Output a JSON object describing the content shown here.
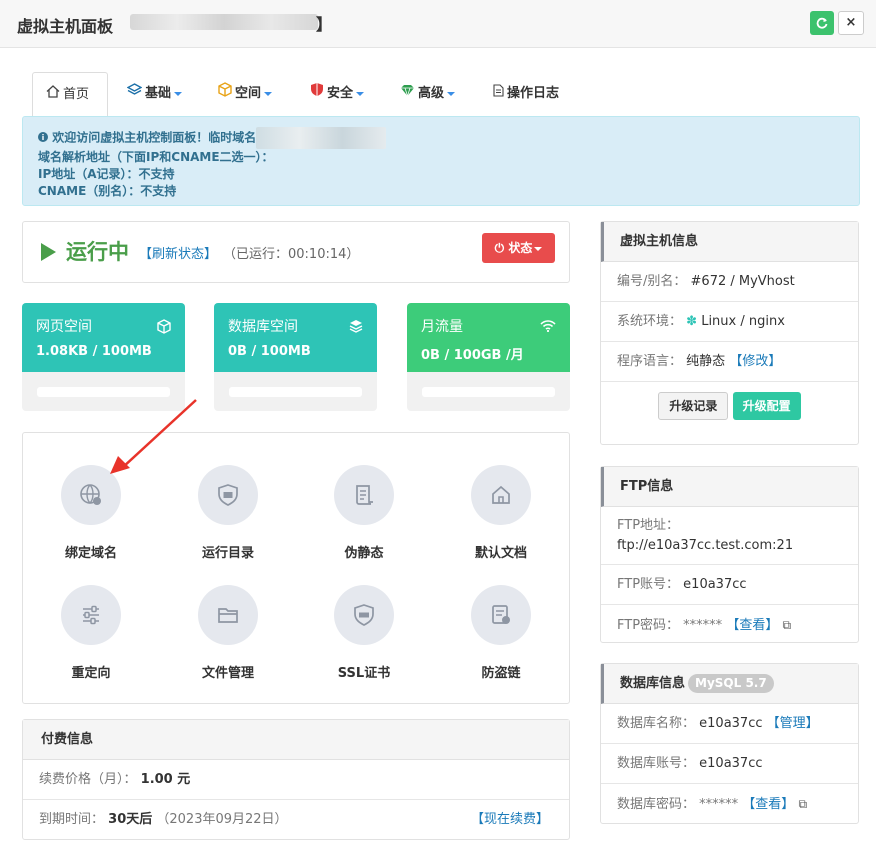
{
  "window": {
    "title": "虚拟主机面板",
    "title_suffix": "】",
    "refresh_icon": "refresh-icon",
    "close_label": "×"
  },
  "tabs": [
    {
      "label": "首页",
      "icon": "home-icon"
    },
    {
      "label": "基础",
      "icon": "layers-icon"
    },
    {
      "label": "空间",
      "icon": "cube-icon"
    },
    {
      "label": "安全",
      "icon": "shield-icon"
    },
    {
      "label": "高级",
      "icon": "diamond-icon"
    },
    {
      "label": "操作日志",
      "icon": "document-icon"
    }
  ],
  "alert": {
    "line1": "欢迎访问虚拟主机控制面板！临时域名",
    "line2": "域名解析地址（下面IP和CNAME二选一）：",
    "line3": "IP地址（A记录）：不支持",
    "line4": "CNAME（别名）：不支持"
  },
  "status": {
    "state": "运行中",
    "refresh_link": "【刷新状态】",
    "uptime": "（已运行：00:10:14）",
    "button": "状态"
  },
  "usage": [
    {
      "label": "网页空间",
      "value": "1.08KB / 100MB",
      "color": "#2ec4b6",
      "icon": "cube-icon",
      "fraction": 0.0
    },
    {
      "label": "数据库空间",
      "value": "0B / 100MB",
      "color": "#2ec4b6",
      "icon": "database-icon",
      "fraction": 0.0
    },
    {
      "label": "月流量",
      "value": "0B / 100GB /月",
      "color": "#3dcc7a",
      "icon": "wifi-icon",
      "fraction": 0.0
    }
  ],
  "functions": [
    {
      "label": "绑定域名",
      "icon": "globe-icon"
    },
    {
      "label": "运行目录",
      "icon": "shield-folder-icon"
    },
    {
      "label": "伪静态",
      "icon": "scroll-icon"
    },
    {
      "label": "默认文档",
      "icon": "home-icon"
    },
    {
      "label": "重定向",
      "icon": "sliders-icon"
    },
    {
      "label": "文件管理",
      "icon": "folder-icon"
    },
    {
      "label": "SSL证书",
      "icon": "ssl-shield-icon"
    },
    {
      "label": "防盗链",
      "icon": "anti-leech-icon"
    }
  ],
  "payment": {
    "title": "付费信息",
    "price_label": "续费价格（月）：",
    "price_value": "1.00 元",
    "expire_label": "到期时间：",
    "expire_value": "30天后",
    "expire_date": "（2023年09月22日）",
    "renew_link": "【现在续费】"
  },
  "host_info": {
    "title": "虚拟主机信息",
    "id_label": "编号/别名：",
    "id_value": "#672 / MyVhost",
    "env_label": "系统环境：",
    "env_value": "Linux / nginx",
    "lang_label": "程序语言：",
    "lang_value": "纯静态",
    "lang_link": "【修改】",
    "btn_log": "升级记录",
    "btn_upgrade": "升级配置"
  },
  "ftp": {
    "title": "FTP信息",
    "addr_label": "FTP地址：",
    "addr_value": "ftp://e10a37cc.test.com:21",
    "user_label": "FTP账号：",
    "user_value": "e10a37cc",
    "pass_label": "FTP密码：",
    "pass_value": "******",
    "view_link": "【查看】"
  },
  "db": {
    "title": "数据库信息",
    "tag": "MySQL 5.7",
    "name_label": "数据库名称：",
    "name_value": "e10a37cc",
    "manage_link": "【管理】",
    "user_label": "数据库账号：",
    "user_value": "e10a37cc",
    "pass_label": "数据库密码：",
    "pass_value": "******",
    "view_link": "【查看】"
  }
}
